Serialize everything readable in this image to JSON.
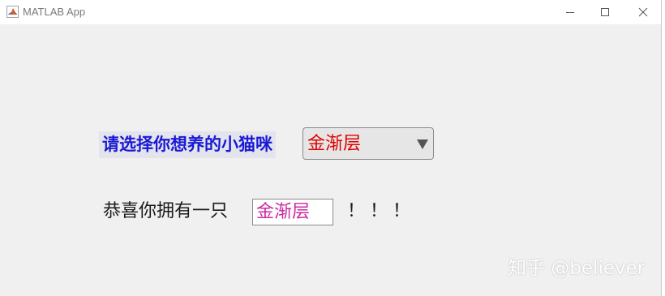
{
  "window": {
    "title": "MATLAB App",
    "icons": {
      "app": "matlab-logo-icon",
      "minimize": "minimize-icon",
      "maximize": "maximize-icon",
      "close": "close-icon"
    }
  },
  "form": {
    "prompt_label": "请选择你想养的小猫咪",
    "dropdown": {
      "selected": "金渐层",
      "value_color": "#e00000",
      "arrow_icon": "triangle-down-icon"
    },
    "result": {
      "prefix": "恭喜你拥有一只",
      "value": "金渐层",
      "value_color": "#cc2aa0",
      "suffix": "！！！"
    }
  },
  "watermark": {
    "text": "知乎 @believer"
  },
  "colors": {
    "prompt_text": "#1a1ad6",
    "prompt_bg": "#e4e4ec",
    "background": "#f0f0f0"
  }
}
